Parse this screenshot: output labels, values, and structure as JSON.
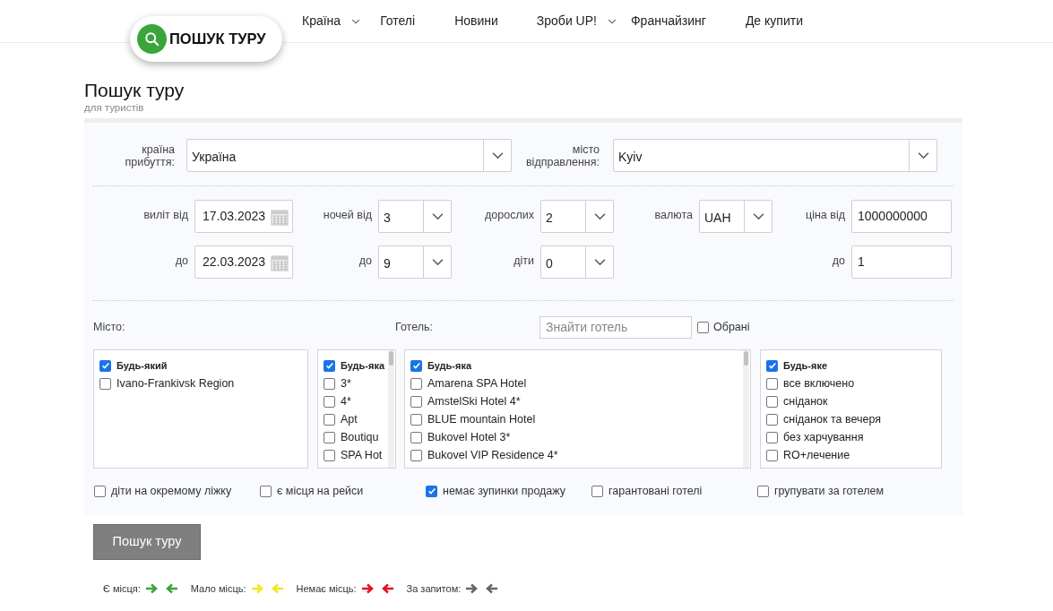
{
  "header": {
    "logo_text": "ПОШУК ТУРУ",
    "nav": [
      {
        "label": "Країна",
        "dropdown": true
      },
      {
        "label": "Готелі",
        "dropdown": false
      },
      {
        "label": "Новини",
        "dropdown": false
      },
      {
        "label": "Зроби UP!",
        "dropdown": true
      },
      {
        "label": "Франчайзинг",
        "dropdown": false
      },
      {
        "label": "Де купити",
        "dropdown": false
      }
    ]
  },
  "page": {
    "title": "Пошук туру",
    "subtitle": "для туристів"
  },
  "form": {
    "top_selects": [
      {
        "label": "країна прибуття:",
        "value": "Україна"
      },
      {
        "label": "місто відправлення:",
        "value": "Kyiv"
      }
    ],
    "columns": [
      {
        "fields": [
          {
            "kind": "date",
            "label": "виліт від",
            "value": "17.03.2023"
          },
          {
            "kind": "date",
            "label": "до",
            "value": "22.03.2023"
          }
        ]
      },
      {
        "fields": [
          {
            "kind": "select",
            "label": "ночей від",
            "value": "3"
          },
          {
            "kind": "select",
            "label": "до",
            "value": "9"
          }
        ]
      },
      {
        "fields": [
          {
            "kind": "select",
            "label": "дорослих",
            "value": "2"
          },
          {
            "kind": "select",
            "label": "діти",
            "value": "0"
          }
        ]
      },
      {
        "fields": [
          {
            "kind": "select",
            "label": "валюта",
            "value": "UAH"
          }
        ]
      },
      {
        "fields": [
          {
            "kind": "input",
            "label": "ціна від",
            "value": "1000000000"
          },
          {
            "kind": "input",
            "label": "до",
            "value": "1"
          }
        ]
      }
    ],
    "city_label": "Місто:",
    "hotel_label": "Готель:",
    "hotel_search": {
      "placeholder": "Знайти готель"
    },
    "favorites": {
      "label": "Обрані",
      "checked": false
    },
    "city_list": [
      {
        "label": "Будь-який",
        "checked": true
      },
      {
        "label": "Ivano-Frankivsk Region",
        "checked": false
      }
    ],
    "category_list": [
      {
        "label": "Будь-яка",
        "checked": true
      },
      {
        "label": "3*",
        "checked": false
      },
      {
        "label": "4*",
        "checked": false
      },
      {
        "label": "Apt",
        "checked": false
      },
      {
        "label": "Boutiqu",
        "checked": false
      },
      {
        "label": "SPA Hot",
        "checked": false
      }
    ],
    "hotel_list": [
      {
        "label": "Будь-яка",
        "checked": true
      },
      {
        "label": "Amarena SPA Hotel",
        "checked": false
      },
      {
        "label": "AmstelSki Hotel 4*",
        "checked": false
      },
      {
        "label": "BLUE mountain Hotel",
        "checked": false
      },
      {
        "label": "Bukovel Hotel 3*",
        "checked": false
      },
      {
        "label": "Bukovel VIP Residence 4*",
        "checked": false
      }
    ],
    "meal_list": [
      {
        "label": "Будь-яке",
        "checked": true
      },
      {
        "label": "все включено",
        "checked": false
      },
      {
        "label": "сніданок",
        "checked": false
      },
      {
        "label": "сніданок та вечеря",
        "checked": false
      },
      {
        "label": "без харчування",
        "checked": false
      },
      {
        "label": "RO+лечение",
        "checked": false
      }
    ],
    "options": [
      {
        "label": "діти на окремому ліжку",
        "checked": false
      },
      {
        "label": "є місця на рейси",
        "checked": false
      },
      {
        "label": "немає зупинки продажу",
        "checked": true
      },
      {
        "label": "гарантовані готелі",
        "checked": false
      },
      {
        "label": "групувати за готелем",
        "checked": false
      }
    ]
  },
  "search_button": "Пошук туру",
  "legend": [
    {
      "label": "Є місця:",
      "color": "#3aa53a"
    },
    {
      "label": "Мало місць:",
      "color": "#f2e81c"
    },
    {
      "label": "Немає місць:",
      "color": "#e5101c"
    },
    {
      "label": "За запитом:",
      "color": "#666666"
    }
  ]
}
